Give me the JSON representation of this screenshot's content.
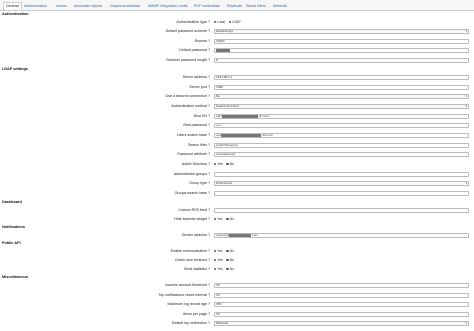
{
  "tabs": [
    "General",
    "Administration",
    "Avisos",
    "Automatic reports",
    "Graphical statistics",
    "WAMP integration",
    "Limits",
    "PDF credentials",
    "Replicate",
    "Saved filters",
    "Webmail"
  ],
  "active_tab": "General",
  "sections": {
    "authentication": {
      "title": "Authentication",
      "auth_type_label": "Authentication type ?",
      "auth_type_options": [
        "Local",
        "LDAP"
      ],
      "auth_type_selected": "LDAP",
      "pw_scheme_label": "Default password scheme ?",
      "pw_scheme_value": "sha512crypt",
      "rounds_label": "Rounds ?",
      "rounds_value": "15000",
      "default_pw_label": "Default password ?",
      "random_len_label": "Random password length ?",
      "random_len_value": "8"
    },
    "ldap": {
      "title": "LDAP settings",
      "server_address_label": "Server address ?",
      "server_address_value": "192.168.1.2",
      "server_port_label": "Server port ?",
      "server_port_value": "1389",
      "secured_label": "Use a secured connection ?",
      "secured_value": "No",
      "auth_method_label": "Authentication method ?",
      "auth_method_value": "Search and bind",
      "bind_dn_label": "Bind DN ?",
      "bind_dn_prefix": "uid=",
      "bind_dn_suffix": ",dc=com",
      "bind_pw_label": "Bind password ?",
      "bind_pw_value": "•••••",
      "users_base_label": "Users search base ?",
      "users_base_prefix": "ou=",
      "users_base_suffix": ",dc=com",
      "search_filter_label": "Search filter ?",
      "search_filter_value": "(mail=%(user)s)",
      "pw_attr_label": "Password attribute ?",
      "pw_attr_value": "userpassword",
      "ad_label": "Active Directory ?",
      "ad_options": [
        "Yes",
        "No"
      ],
      "ad_selected": "No",
      "admin_groups_label": "Administrator groups ?",
      "group_type_label": "Group type ?",
      "group_type_value": "PosixGroup",
      "groups_base_label": "Groups search base ?"
    },
    "dashboard": {
      "title": "Dashboard",
      "rss_label": "Custom RSS feed ?",
      "hide_widget_label": "Hide features widget ?",
      "hide_widget_options": [
        "Yes",
        "No"
      ],
      "hide_widget_selected": "No"
    },
    "notifications": {
      "title": "Notifications",
      "sender_label": "Sender address ?",
      "sender_prefix": "noreply@",
      "sender_suffix": ".com"
    },
    "public_api": {
      "title": "Public API",
      "enable_comm_label": "Enable communication ?",
      "enable_comm_options": [
        "Yes",
        "No"
      ],
      "enable_comm_selected": "No",
      "check_versions_label": "Check new versions ?",
      "check_versions_options": [
        "Yes",
        "No"
      ],
      "check_versions_selected": "Yes",
      "send_stats_label": "Send statistics ?",
      "send_stats_options": [
        "Yes",
        "No"
      ],
      "send_stats_selected": "No"
    },
    "misc": {
      "title": "Miscellaneous",
      "inactive_label": "Inactive account threshold ?",
      "inactive_value": "30",
      "top_notif_label": "Top notifications check interval ?",
      "top_notif_value": "30",
      "max_log_label": "Maximum log record age ?",
      "max_log_value": "365",
      "items_label": "Items per page ?",
      "items_value": "30",
      "top_redirect_label": "Default top redirection ?",
      "top_redirect_value": "Webmail"
    }
  }
}
